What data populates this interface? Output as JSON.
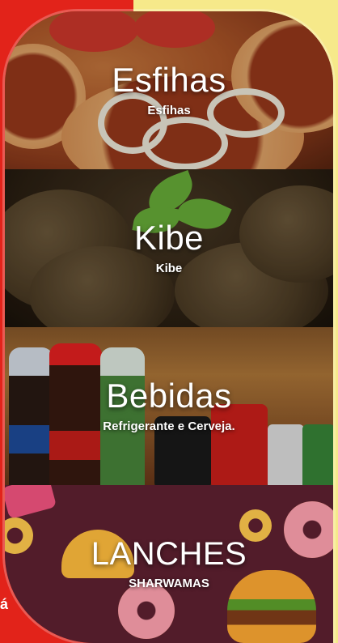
{
  "categories": [
    {
      "title": "Esfihas",
      "subtitle": "Esfihas"
    },
    {
      "title": "Kibe",
      "subtitle": "Kibe"
    },
    {
      "title": "Bebidas",
      "subtitle": "Refrigerante e Cerveja."
    },
    {
      "title": "LANCHES",
      "subtitle": "SHARWAMAS"
    }
  ],
  "left_partial_text": "á",
  "colors": {
    "background_yellow": "#f6e98a",
    "brand_red": "#e2231a"
  }
}
